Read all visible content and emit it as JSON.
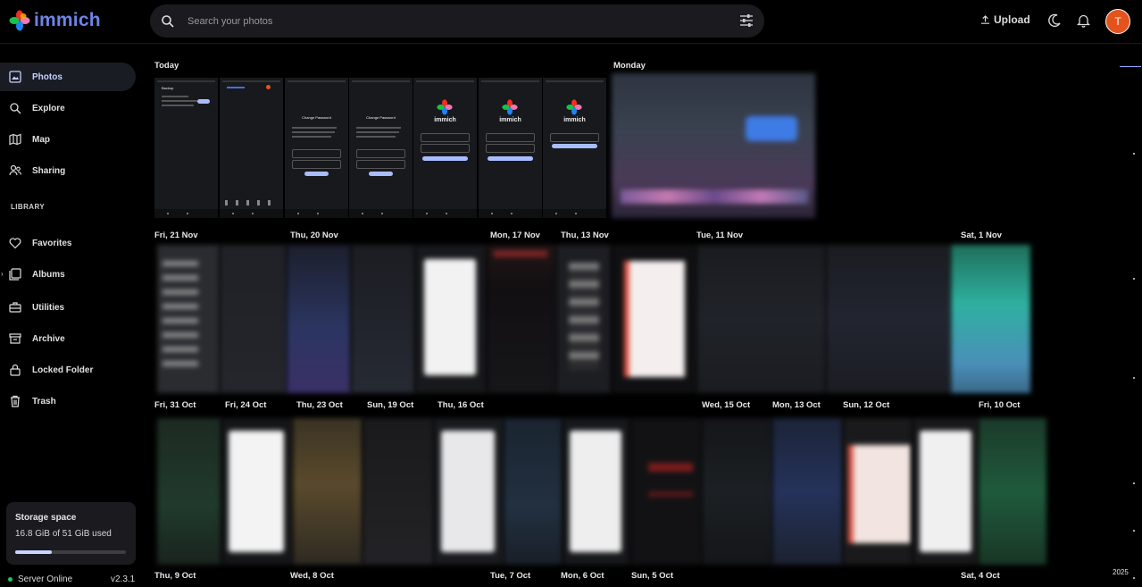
{
  "app": {
    "name": "immich",
    "version": "v2.3.1"
  },
  "header": {
    "search_placeholder": "Search your photos",
    "upload_label": "Upload",
    "avatar_initial": "T"
  },
  "sidebar": {
    "items": [
      {
        "label": "Photos",
        "icon": "photos-icon",
        "active": true
      },
      {
        "label": "Explore",
        "icon": "search-icon"
      },
      {
        "label": "Map",
        "icon": "map-icon"
      },
      {
        "label": "Sharing",
        "icon": "sharing-icon"
      }
    ],
    "library_heading": "LIBRARY",
    "library_items": [
      {
        "label": "Favorites",
        "icon": "heart-icon"
      },
      {
        "label": "Albums",
        "icon": "albums-icon"
      },
      {
        "label": "Utilities",
        "icon": "toolbox-icon"
      },
      {
        "label": "Archive",
        "icon": "archive-icon"
      },
      {
        "label": "Locked Folder",
        "icon": "lock-icon"
      },
      {
        "label": "Trash",
        "icon": "trash-icon"
      }
    ],
    "storage": {
      "title": "Storage space",
      "usage": "16.8 GiB of 51 GiB used",
      "used_fraction": 0.33
    },
    "server_status": "Server Online"
  },
  "timeline": {
    "row1": [
      "Today",
      "Monday"
    ],
    "row2": [
      "Fri, 21 Nov",
      "Thu, 20 Nov",
      "Mon, 17 Nov",
      "Thu, 13 Nov",
      "Tue, 11 Nov",
      "Sat, 1 Nov"
    ],
    "row3": [
      "Fri, 31 Oct",
      "Fri, 24 Oct",
      "Thu, 23 Oct",
      "Sun, 19 Oct",
      "Thu, 16 Oct",
      "Wed, 15 Oct",
      "Mon, 13 Oct",
      "Sun, 12 Oct",
      "Fri, 10 Oct"
    ],
    "row4": [
      "Thu, 9 Oct",
      "Wed, 8 Oct",
      "Tue, 7 Oct",
      "Mon, 6 Oct",
      "Sun, 5 Oct",
      "Sat, 4 Oct"
    ],
    "shots": {
      "backup_title": "Backup",
      "change_password": "Change Password",
      "immich": "immich"
    }
  },
  "scrubber": {
    "year": "2025"
  },
  "colors": {
    "accent": "#c6d0ff",
    "avatar": "#e5531c",
    "online": "#22c55e"
  }
}
